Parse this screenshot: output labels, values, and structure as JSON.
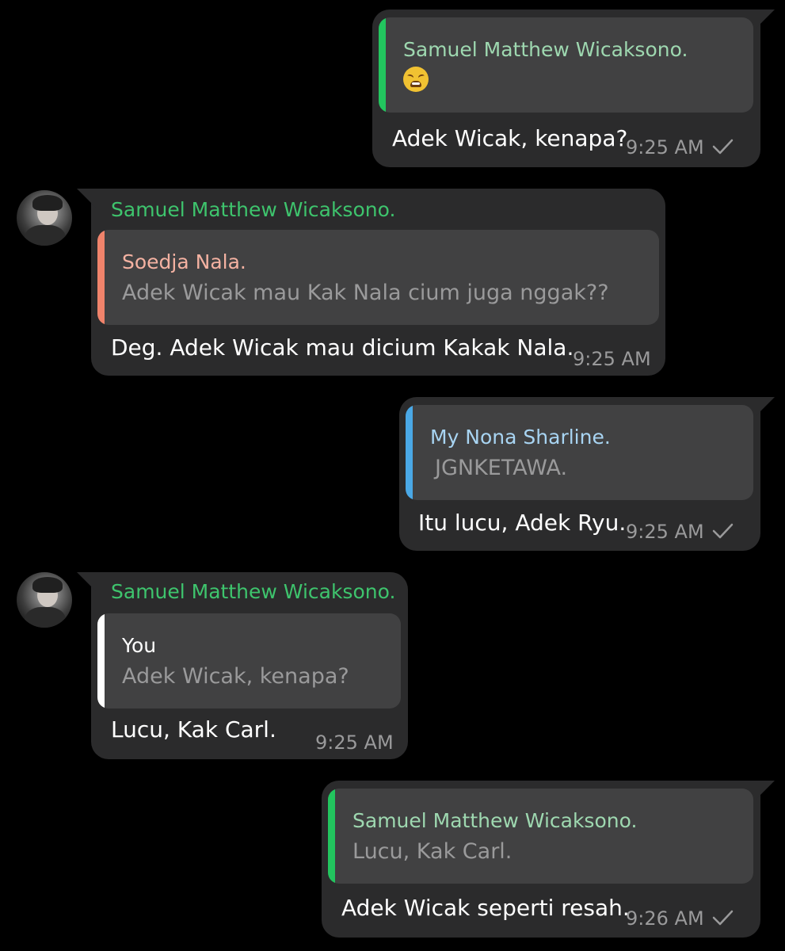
{
  "colors": {
    "background": "#000000",
    "bubble": "#2b2b2c",
    "quote_box": "#414142",
    "text": "#ffffff",
    "muted_text": "#9a9a9b",
    "sender_green": "#3ec46d",
    "quote_green": "#22c55e",
    "quote_salmon": "#f0836b",
    "quote_blue": "#4aa8e6",
    "quote_white": "#ffffff"
  },
  "messages": [
    {
      "direction": "outgoing",
      "quote": {
        "name": "Samuel Matthew Wicaksono.",
        "name_color": "#9ed8b0",
        "bar_color": "#22c55e",
        "emoji": "weary-face-emoji"
      },
      "text": "Adek Wicak, kenapa?",
      "time": "9:25 AM",
      "status_icon": "single-check-icon"
    },
    {
      "direction": "incoming",
      "sender": "Samuel Matthew Wicaksono.",
      "avatar": "contact-avatar",
      "quote": {
        "name": "Soedja Nala.",
        "name_color": "#f4b2a2",
        "bar_color": "#f0836b",
        "text": "Adek Wicak mau Kak Nala cium juga nggak??"
      },
      "text": "Deg. Adek Wicak mau dicium Kakak Nala.",
      "time": "9:25 AM"
    },
    {
      "direction": "outgoing",
      "quote": {
        "name": "My Nona Sharline.",
        "name_color": "#a8d4f2",
        "bar_color": "#4aa8e6",
        "text": "JGNKETAWA."
      },
      "text": "Itu lucu, Adek Ryu.",
      "time": "9:25 AM",
      "status_icon": "single-check-icon"
    },
    {
      "direction": "incoming",
      "sender": "Samuel Matthew Wicaksono.",
      "avatar": "contact-avatar",
      "quote": {
        "name": "You",
        "name_color": "#ffffff",
        "bar_color": "#ffffff",
        "text": "Adek Wicak, kenapa?"
      },
      "text": "Lucu, Kak Carl.",
      "time": "9:25 AM"
    },
    {
      "direction": "outgoing",
      "quote": {
        "name": "Samuel Matthew Wicaksono.",
        "name_color": "#9ed8b0",
        "bar_color": "#22c55e",
        "text": "Lucu, Kak Carl."
      },
      "text": "Adek Wicak seperti resah.",
      "time": "9:26 AM",
      "status_icon": "single-check-icon"
    }
  ]
}
